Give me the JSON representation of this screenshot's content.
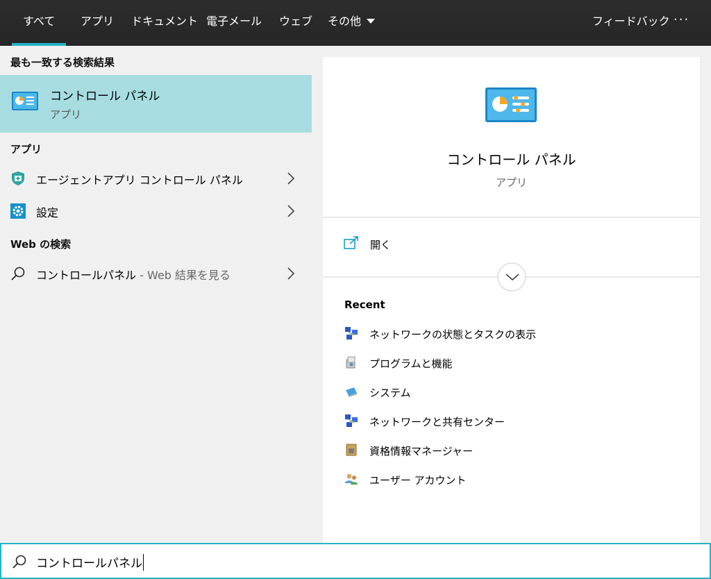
{
  "tabs": [
    {
      "label": "すべて",
      "active": true
    },
    {
      "label": "アプリ"
    },
    {
      "label": "ドキュメント"
    },
    {
      "label": "電子メール"
    },
    {
      "label": "ウェブ"
    },
    {
      "label": "その他"
    }
  ],
  "feedback_label": "フィードバック",
  "more_label": "···",
  "left": {
    "best_match_heading": "最も一致する検索結果",
    "best_match": {
      "title": "コントロール パネル",
      "subtitle": "アプリ",
      "icon": "control-panel-icon"
    },
    "apps_heading": "アプリ",
    "apps": [
      {
        "label": "エージェントアプリ コントロール パネル",
        "icon": "shield-icon"
      },
      {
        "label": "設定",
        "icon": "gear-icon"
      }
    ],
    "web_heading": "Web の検索",
    "web": {
      "label": "コントロールパネル",
      "suffix": " - Web 結果を見る",
      "icon": "search-icon"
    }
  },
  "right": {
    "title": "コントロール パネル",
    "subtitle": "アプリ",
    "open_label": "開く",
    "recent_heading": "Recent",
    "recent": [
      {
        "label": "ネットワークの状態とタスクの表示",
        "icon": "network-icon"
      },
      {
        "label": "プログラムと機能",
        "icon": "programs-icon"
      },
      {
        "label": "システム",
        "icon": "system-icon"
      },
      {
        "label": "ネットワークと共有センター",
        "icon": "network-icon"
      },
      {
        "label": "資格情報マネージャー",
        "icon": "credential-icon"
      },
      {
        "label": "ユーザー アカウント",
        "icon": "users-icon"
      }
    ]
  },
  "search": {
    "value": "コントロールパネル"
  },
  "colors": {
    "accent": "#23b3c7",
    "selection": "#a7dde1",
    "topbar": "#2b2b2b"
  }
}
